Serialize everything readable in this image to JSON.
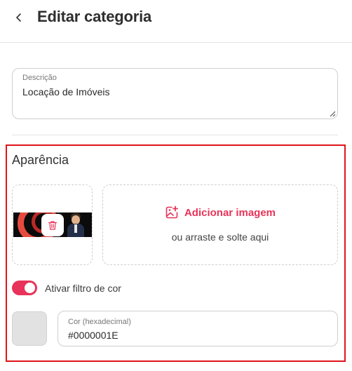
{
  "header": {
    "title": "Editar categoria",
    "back_icon": "chevron-left-icon"
  },
  "description_field": {
    "label": "Descrição",
    "value": "Locação de Imóveis"
  },
  "appearance": {
    "title": "Aparência",
    "image_slot": {
      "delete_icon": "trash-icon"
    },
    "add_image": {
      "label": "Adicionar imagem",
      "icon": "image-plus-icon",
      "hint": "ou arraste e solte aqui"
    },
    "color_filter": {
      "label": "Ativar filtro de cor",
      "enabled": true
    },
    "color_field": {
      "label": "Cor (hexadecimal)",
      "value": "#0000001E",
      "swatch_color": "#e2e2e2"
    }
  },
  "colors": {
    "accent": "#e8335a",
    "highlight_border": "#e0141b"
  }
}
